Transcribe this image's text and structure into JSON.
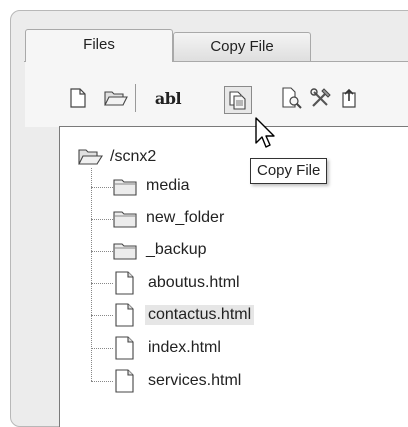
{
  "tabs": [
    {
      "label": "Files",
      "active": true
    },
    {
      "label": "Copy File",
      "active": false
    }
  ],
  "toolbar": {
    "buttons": [
      {
        "icon": "new-file-icon"
      },
      {
        "icon": "open-folder-icon"
      },
      {
        "text": "abl",
        "icon": "rename-icon"
      },
      {
        "icon": "copy-file-icon",
        "pressed": true
      },
      {
        "icon": "search-file-icon"
      },
      {
        "icon": "tools-icon"
      },
      {
        "icon": "upload-icon"
      }
    ],
    "tooltip": "Copy File"
  },
  "tree": {
    "root": "/scnx2",
    "items": [
      {
        "label": "media",
        "type": "folder"
      },
      {
        "label": "new_folder",
        "type": "folder"
      },
      {
        "label": "_backup",
        "type": "folder"
      },
      {
        "label": "aboutus.html",
        "type": "file"
      },
      {
        "label": "contactus.html",
        "type": "file",
        "selected": true
      },
      {
        "label": "index.html",
        "type": "file"
      },
      {
        "label": "services.html",
        "type": "file"
      }
    ]
  }
}
